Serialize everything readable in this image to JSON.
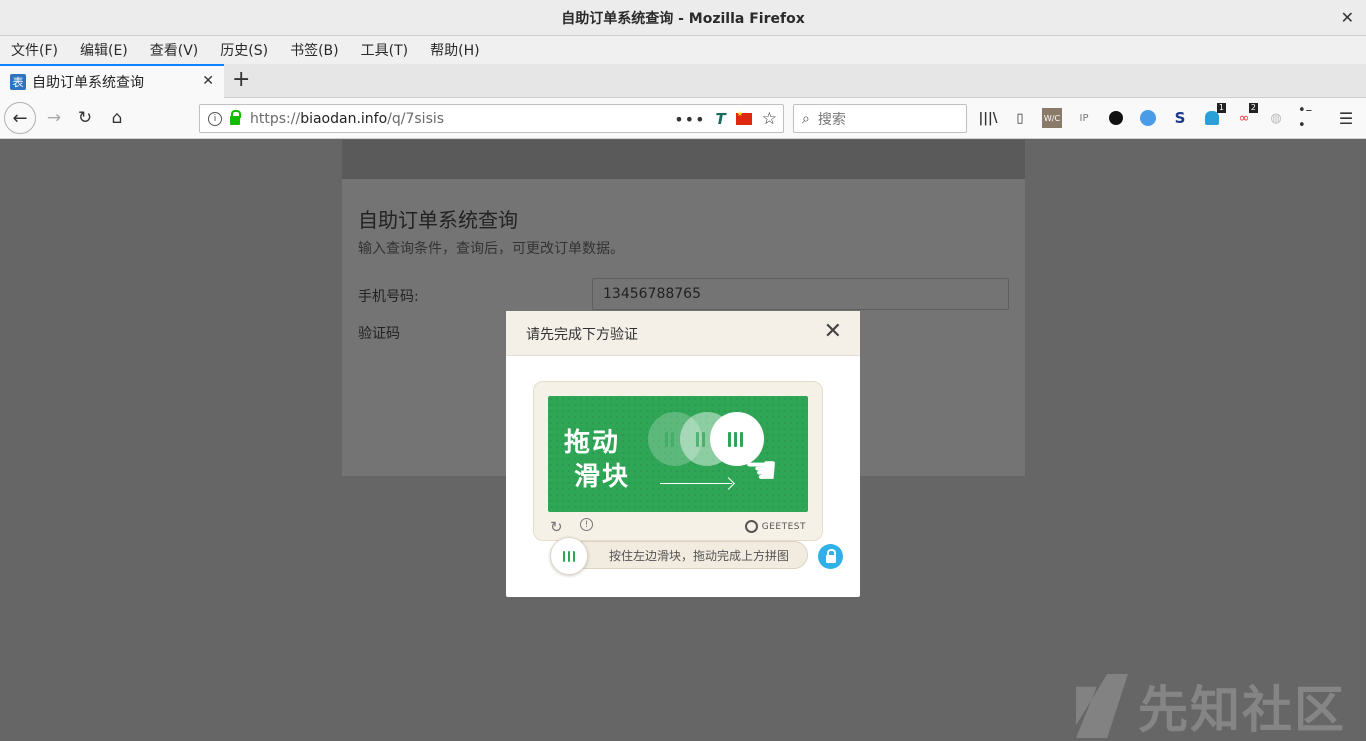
{
  "window": {
    "title": "自助订单系统查询 - Mozilla Firefox",
    "close_glyph": "✕"
  },
  "menu": [
    {
      "label": "文件(F)"
    },
    {
      "label": "编辑(E)"
    },
    {
      "label": "查看(V)"
    },
    {
      "label": "历史(S)"
    },
    {
      "label": "书签(B)"
    },
    {
      "label": "工具(T)"
    },
    {
      "label": "帮助(H)"
    }
  ],
  "tab": {
    "favicon_text": "表",
    "label": "自助订单系统查询",
    "close_glyph": "✕",
    "new_tab_glyph": "+"
  },
  "nav": {
    "url_scheme": "https://",
    "url_host": "biaodan.info",
    "url_path": "/q/7sisis",
    "search_placeholder": "搜索",
    "extension_badge_1": "1",
    "extension_badge_2": "2",
    "wc_label": "W/C",
    "ip_label": "IP",
    "s_label": "S"
  },
  "page": {
    "title": "自助订单系统查询",
    "subtitle": "输入查询条件，查询后，可更改订单数据。",
    "phone_label": "手机号码:",
    "phone_value": "13456788765",
    "code_label": "验证码"
  },
  "modal": {
    "title": "请先完成下方验证",
    "close_glyph": "✕",
    "image_text_line1": "拖动",
    "image_text_line2": "滑块",
    "brand": "GEETEST",
    "slider_hint": "按住左边滑块，拖动完成上方拼图"
  },
  "watermark": {
    "text": "先知社区"
  },
  "colors": {
    "geetest_green": "#2fa556",
    "lock_blue": "#2fb1e8",
    "tab_accent": "#0a84ff"
  }
}
